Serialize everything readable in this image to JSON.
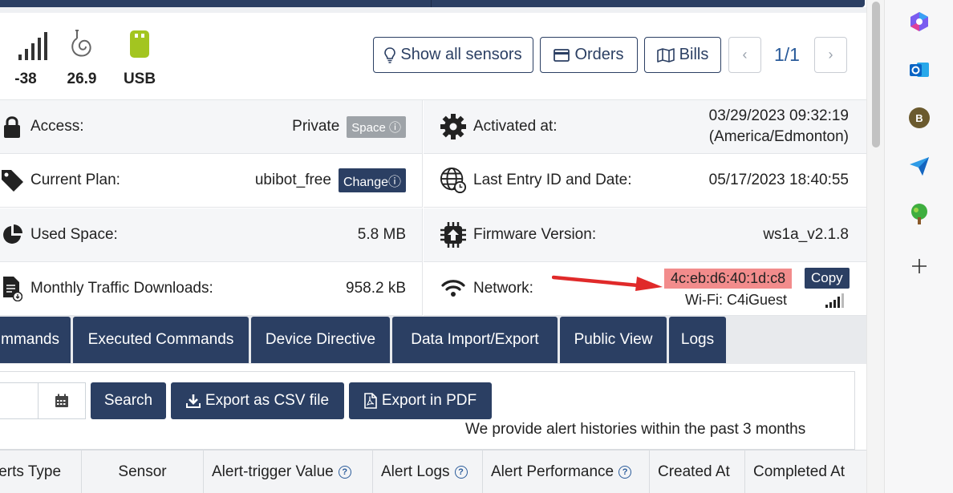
{
  "sensors": {
    "signal": "-38",
    "temperature": "26.9",
    "power": "USB"
  },
  "header": {
    "show_sensors": "Show all sensors",
    "orders": "Orders",
    "bills": "Bills",
    "page": "1/1"
  },
  "info": {
    "access_label": "Access:",
    "access_value": "Private",
    "space_badge": "Space",
    "plan_label": "Current Plan:",
    "plan_value": "ubibot_free",
    "change_badge": "Change",
    "used_label": "Used Space:",
    "used_value": "5.8 MB",
    "traffic_label": "Monthly Traffic Downloads:",
    "traffic_value": "958.2 kB",
    "activated_label": "Activated at:",
    "activated_date": "03/29/2023 09:32:19",
    "activated_tz": "(America/Edmonton)",
    "entry_label": "Last Entry ID and Date:",
    "entry_value": "05/17/2023 18:40:55",
    "firmware_label": "Firmware Version:",
    "firmware_value": "ws1a_v2.1.8",
    "network_label": "Network:",
    "mac": "4c:eb:d6:40:1d:c8",
    "copy": "Copy",
    "wifi": "Wi-Fi: C4iGuest"
  },
  "tabs": [
    "mmands",
    "Executed Commands",
    "Device Directive",
    "Data Import/Export",
    "Public View",
    "Logs"
  ],
  "filters": {
    "search": "Search",
    "export_csv": "Export as CSV file",
    "export_pdf": "Export in PDF",
    "note": "We provide alert histories within the past 3 months"
  },
  "table": {
    "headers": [
      "lerts Type",
      "Sensor",
      "Alert-trigger Value",
      "Alert Logs",
      "Alert Performance",
      "Created At",
      "Completed At"
    ]
  },
  "colors": {
    "primary": "#2b3f63",
    "highlight": "#f28c8c",
    "arrow": "#e02a2a",
    "usb": "#a3c520"
  }
}
